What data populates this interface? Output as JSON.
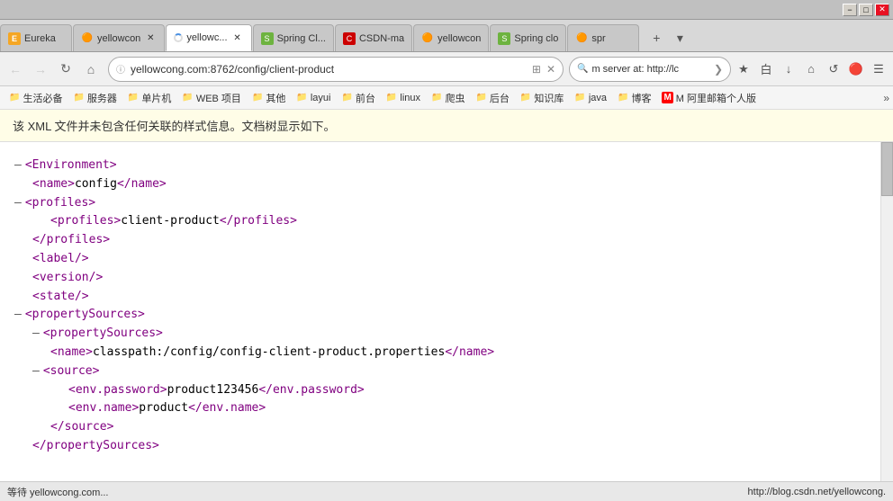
{
  "titlebar": {
    "minimize": "−",
    "maximize": "□",
    "close": "✕"
  },
  "tabs": [
    {
      "id": "eureka",
      "label": "Eureka",
      "favicon_type": "fav-eureka",
      "favicon_text": "E",
      "active": false,
      "closable": false
    },
    {
      "id": "yellowcong1",
      "label": "yellowcon",
      "favicon_type": "fav-yellow",
      "favicon_text": "🔴",
      "active": false,
      "closable": true
    },
    {
      "id": "yellowcong2",
      "label": "yellowc...",
      "favicon_type": "fav-loading",
      "favicon_text": "",
      "active": true,
      "closable": true
    },
    {
      "id": "spring-cloud",
      "label": "Spring Cl...",
      "favicon_type": "fav-spring",
      "favicon_text": "S",
      "active": false,
      "closable": false
    },
    {
      "id": "csdn",
      "label": "CSDN-ma",
      "favicon_type": "fav-csdn",
      "favicon_text": "C",
      "active": false,
      "closable": false
    },
    {
      "id": "yellowcong3",
      "label": "yellowcon",
      "favicon_type": "fav-yellow",
      "favicon_text": "🔴",
      "active": false,
      "closable": false
    },
    {
      "id": "spring-clo2",
      "label": "Spring clo",
      "favicon_type": "fav-spring",
      "favicon_text": "S",
      "active": false,
      "closable": false
    },
    {
      "id": "spr",
      "label": "spr",
      "favicon_type": "fav-yellow",
      "favicon_text": "🔴",
      "active": false,
      "closable": false
    }
  ],
  "tab_actions": {
    "new_tab": "+",
    "more": "▾"
  },
  "navbar": {
    "back": "←",
    "forward": "→",
    "refresh": "↻",
    "home": "⌂",
    "address": "yellowcong.com:8762/config/client-product",
    "address_protocol": "ⓘ",
    "address_clear": "✕",
    "address_qr": "⊞",
    "search_placeholder": "m server at: http://lc",
    "search_icon": "🔍",
    "search_arrow": "❯",
    "nav_icons": [
      "★",
      "白",
      "↓",
      "⌂",
      "↺",
      "☰"
    ]
  },
  "bookmarks": [
    {
      "label": "生活必备",
      "icon": "📁"
    },
    {
      "label": "服务器",
      "icon": "📁"
    },
    {
      "label": "单片机",
      "icon": "📁"
    },
    {
      "label": "WEB 项目",
      "icon": "📁"
    },
    {
      "label": "其他",
      "icon": "📁"
    },
    {
      "label": "layui",
      "icon": "📁"
    },
    {
      "label": "前台",
      "icon": "📁"
    },
    {
      "label": "linux",
      "icon": "📁"
    },
    {
      "label": "爬虫",
      "icon": "📁"
    },
    {
      "label": "后台",
      "icon": "📁"
    },
    {
      "label": "知识库",
      "icon": "📁"
    },
    {
      "label": "java",
      "icon": "📁"
    },
    {
      "label": "博客",
      "icon": "📁"
    },
    {
      "label": "M 阿里邮箱个人版",
      "icon": "M"
    }
  ],
  "infobar": {
    "text": "该 XML 文件并未包含任何关联的样式信息。文档树显示如下。"
  },
  "xml_lines": [
    {
      "indent": 0,
      "collapse": "–",
      "content": "<Environment>",
      "tag_parts": [
        "<",
        "Environment",
        ">"
      ],
      "type": "tag"
    },
    {
      "indent": 1,
      "collapse": "",
      "content": "<name>config</name>",
      "type": "tag-text"
    },
    {
      "indent": 0,
      "collapse": "–",
      "content": "<profiles>",
      "tag_parts": [
        "<",
        "profiles",
        ">"
      ],
      "type": "tag"
    },
    {
      "indent": 2,
      "collapse": "",
      "content": "<profiles>client-product</profiles>",
      "type": "tag-text"
    },
    {
      "indent": 1,
      "collapse": "",
      "content": "</profiles>",
      "type": "close-tag"
    },
    {
      "indent": 1,
      "collapse": "",
      "content": "<label/>",
      "type": "self-close"
    },
    {
      "indent": 1,
      "collapse": "",
      "content": "<version/>",
      "type": "self-close"
    },
    {
      "indent": 1,
      "collapse": "",
      "content": "<state/>",
      "type": "self-close"
    },
    {
      "indent": 0,
      "collapse": "–",
      "content": "<propertySources>",
      "type": "tag"
    },
    {
      "indent": 1,
      "collapse": "–",
      "content": "<propertySources>",
      "type": "tag"
    },
    {
      "indent": 2,
      "collapse": "",
      "content": "<name>classpath:/config/config-client-product.properties</name>",
      "type": "tag-text"
    },
    {
      "indent": 1,
      "collapse": "–",
      "content": "<source>",
      "type": "tag"
    },
    {
      "indent": 3,
      "collapse": "",
      "content": "<env.password>product123456 </env.password>",
      "type": "tag-text"
    },
    {
      "indent": 3,
      "collapse": "",
      "content": "<env.name>product </env.name>",
      "type": "tag-text"
    },
    {
      "indent": 2,
      "collapse": "",
      "content": "</source>",
      "type": "close-tag"
    },
    {
      "indent": 1,
      "collapse": "",
      "content": "</propertySources>",
      "type": "close-tag-partial"
    }
  ],
  "statusbar": {
    "left": "等待 yellowcong.com...",
    "right": "http://blog.csdn.net/yellowcong."
  }
}
